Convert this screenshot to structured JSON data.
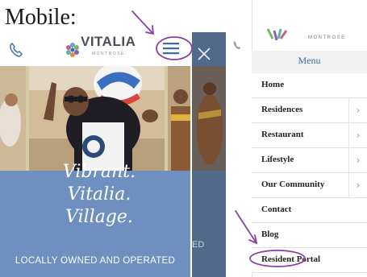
{
  "heading": "Mobile:",
  "site": {
    "logo_name": "VITALIA",
    "logo_location": "MONTROSE",
    "tagline_line1": "Vibrant. Vitalia.",
    "tagline_line2": "Village.",
    "subline": "LOCALLY OWNED AND OPERATED",
    "mid_text": "ED"
  },
  "menu": {
    "logo_location": "MONTROSE",
    "title": "Menu",
    "items": [
      {
        "label": "Home",
        "has_submenu": false
      },
      {
        "label": "Residences",
        "has_submenu": true
      },
      {
        "label": "Restaurant",
        "has_submenu": true
      },
      {
        "label": "Lifestyle",
        "has_submenu": true
      },
      {
        "label": "Our Community",
        "has_submenu": true
      },
      {
        "label": "Contact",
        "has_submenu": false
      },
      {
        "label": "Blog",
        "has_submenu": false
      },
      {
        "label": "Resident Portal",
        "has_submenu": false
      }
    ],
    "chevron": "›"
  },
  "colors": {
    "annotation": "#8a3fa8",
    "hero_band": "#6e8fbf",
    "menu_title": "#3c6ca5"
  }
}
